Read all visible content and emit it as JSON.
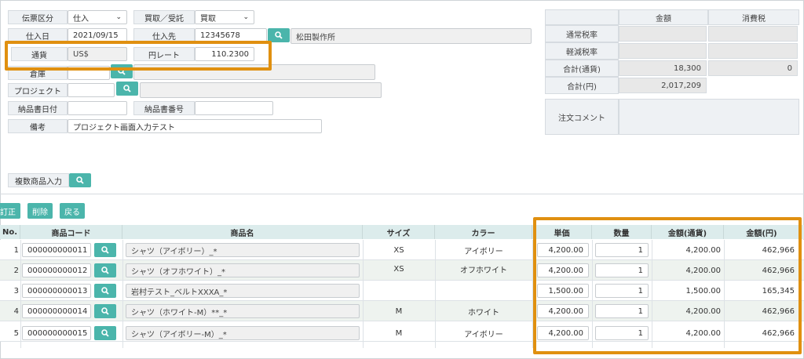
{
  "header": {
    "slip_type": {
      "label": "伝票区分",
      "value": "仕入"
    },
    "purchase_sale": {
      "label": "買取／受託",
      "value": "買取"
    },
    "purchase_date": {
      "label": "仕入日",
      "value": "2021/09/15"
    },
    "supplier": {
      "label": "仕入先",
      "code": "12345678",
      "name": "松田製作所"
    },
    "currency": {
      "label": "通貨",
      "value": "US$"
    },
    "yen_rate": {
      "label": "円レート",
      "value": "110.2300"
    },
    "warehouse": {
      "label": "倉庫",
      "code": "",
      "name": ""
    },
    "project": {
      "label": "プロジェクト",
      "code": "",
      "name": ""
    },
    "delivery_date": {
      "label": "納品書日付",
      "value": ""
    },
    "delivery_no": {
      "label": "納品書番号",
      "value": ""
    },
    "remarks": {
      "label": "備考",
      "value": "プロジェクト画面入力テスト"
    }
  },
  "totals": {
    "col_amount": "金額",
    "col_tax": "消費税",
    "rows": [
      {
        "label": "通常税率",
        "amount": "",
        "tax": ""
      },
      {
        "label": "軽減税率",
        "amount": "",
        "tax": ""
      },
      {
        "label": "合計(通貨)",
        "amount": "18,300",
        "tax": "0"
      },
      {
        "label": "合計(円)",
        "amount": "2,017,209"
      }
    ],
    "comment_label": "注文コメント"
  },
  "multi_input_label": "複数商品入力",
  "actions": {
    "correct": "訂正",
    "delete": "削除",
    "back": "戻る"
  },
  "table": {
    "headers": [
      "No.",
      "商品コード",
      "商品名",
      "サイズ",
      "カラー",
      "単価",
      "数量",
      "金額(通貨)",
      "金額(円)"
    ],
    "rows": [
      {
        "no": "1",
        "code": "000000000011",
        "name": "シャツ（アイボリー）_*",
        "size": "XS",
        "color": "アイボリー",
        "price": "4,200.00",
        "qty": "1",
        "amt": "4,200.00",
        "yen": "462,966"
      },
      {
        "no": "2",
        "code": "000000000012",
        "name": "シャツ（オフホワイト）_*",
        "size": "XS",
        "color": "オフホワイト",
        "price": "4,200.00",
        "qty": "1",
        "amt": "4,200.00",
        "yen": "462,966"
      },
      {
        "no": "3",
        "code": "000000000013",
        "name": "岩村テスト_ベルトXXXA_*",
        "size": "",
        "color": "",
        "price": "1,500.00",
        "qty": "1",
        "amt": "1,500.00",
        "yen": "165,345"
      },
      {
        "no": "4",
        "code": "000000000014",
        "name": "シャツ（ホワイト-M）**_*",
        "size": "M",
        "color": "ホワイト",
        "price": "4,200.00",
        "qty": "1",
        "amt": "4,200.00",
        "yen": "462,966"
      },
      {
        "no": "5",
        "code": "000000000015",
        "name": "シャツ（アイボリー-M）_*",
        "size": "M",
        "color": "アイボリー",
        "price": "4,200.00",
        "qty": "1",
        "amt": "4,200.00",
        "yen": "462,966"
      }
    ]
  },
  "icons": {
    "search": "search-icon",
    "dropdown": "chevron-down-icon"
  },
  "colors": {
    "accent": "#4bb5ab",
    "highlight": "#e09010"
  }
}
